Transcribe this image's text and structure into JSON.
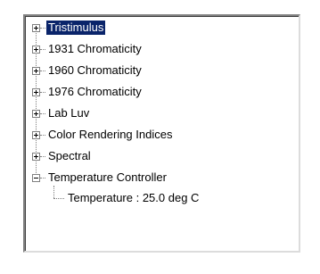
{
  "tree": {
    "items": [
      {
        "label": "Tristimulus",
        "expanded": false,
        "selected": true
      },
      {
        "label": "1931 Chromaticity",
        "expanded": false,
        "selected": false
      },
      {
        "label": "1960 Chromaticity",
        "expanded": false,
        "selected": false
      },
      {
        "label": "1976 Chromaticity",
        "expanded": false,
        "selected": false
      },
      {
        "label": "Lab Luv",
        "expanded": false,
        "selected": false
      },
      {
        "label": "Color Rendering Indices",
        "expanded": false,
        "selected": false
      },
      {
        "label": "Spectral",
        "expanded": false,
        "selected": false
      },
      {
        "label": "Temperature Controller",
        "expanded": true,
        "selected": false,
        "children": [
          {
            "label": "Temperature : 25.0 deg C"
          }
        ]
      }
    ]
  },
  "colors": {
    "selection_bg": "#0a246a",
    "selection_fg": "#ffffff",
    "tree_lines": "#808080"
  }
}
